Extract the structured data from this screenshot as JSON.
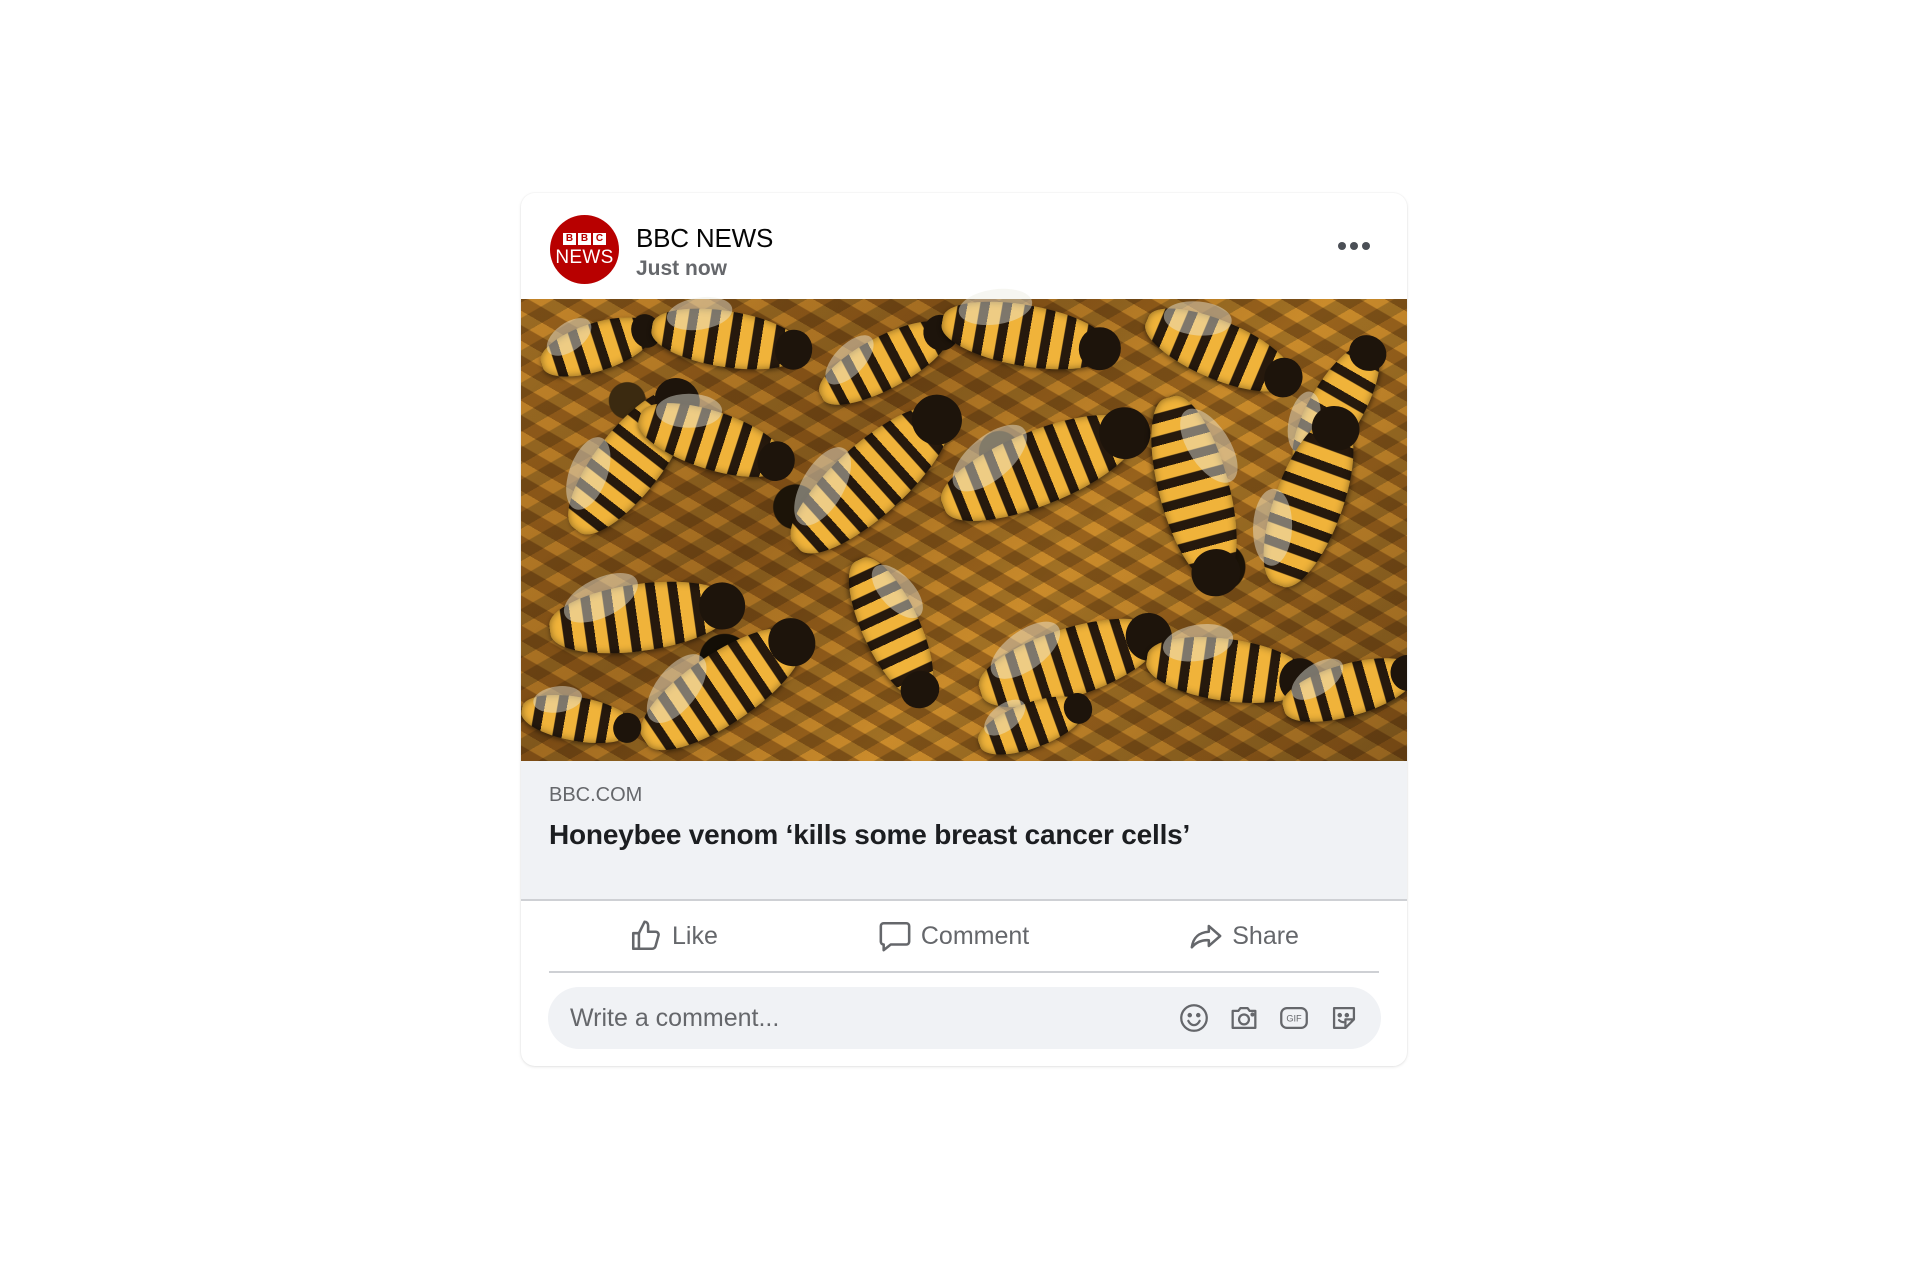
{
  "post": {
    "author": "BBC NEWS",
    "time": "Just now",
    "avatar_logo": {
      "blocks": [
        "B",
        "B",
        "C"
      ],
      "word": "NEWS"
    },
    "image_description": "Honeybees on honeycomb"
  },
  "link_preview": {
    "domain": "BBC.COM",
    "headline": "Honeybee venom ‘kills some breast cancer cells’"
  },
  "actions": {
    "like": "Like",
    "comment": "Comment",
    "share": "Share"
  },
  "comment_box": {
    "placeholder": "Write a comment..."
  },
  "icons": {
    "more": "more-options-icon",
    "like": "thumbs-up-icon",
    "comment": "speech-bubble-icon",
    "share": "share-arrow-icon",
    "emoji": "emoji-icon",
    "camera": "camera-icon",
    "gif": "gif-icon",
    "sticker": "sticker-icon"
  },
  "colors": {
    "brand_red": "#b80000",
    "text_secondary": "#65676b",
    "preview_bg": "#f0f2f5"
  }
}
